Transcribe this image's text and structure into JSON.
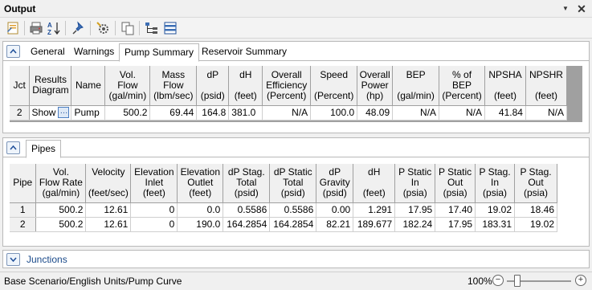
{
  "window": {
    "title": "Output"
  },
  "toolbar": {
    "icons": [
      "report-icon",
      "print-icon",
      "sort-az-icon",
      "pin-icon",
      "settings-icon",
      "copy-icon",
      "tree-icon",
      "columns-icon"
    ]
  },
  "top_panel": {
    "tabs": [
      {
        "label": "General"
      },
      {
        "label": "Warnings"
      },
      {
        "label": "Pump Summary"
      },
      {
        "label": "Reservoir Summary"
      }
    ],
    "active_tab": "Pump Summary",
    "columns": [
      [
        "Jct",
        ""
      ],
      [
        "Results",
        "Diagram"
      ],
      [
        "Name",
        ""
      ],
      [
        "Vol.",
        "Flow",
        "(gal/min)"
      ],
      [
        "Mass",
        "Flow",
        "(lbm/sec)"
      ],
      [
        "dP",
        "",
        "(psid)"
      ],
      [
        "dH",
        "",
        "(feet)"
      ],
      [
        "Overall",
        "Efficiency",
        "(Percent)"
      ],
      [
        "Speed",
        "",
        "(Percent)"
      ],
      [
        "Overall",
        "Power",
        "(hp)"
      ],
      [
        "BEP",
        "",
        "(gal/min)"
      ],
      [
        "% of",
        "BEP",
        "(Percent)"
      ],
      [
        "NPSHA",
        "",
        "(feet)"
      ],
      [
        "NPSHR",
        "",
        "(feet)"
      ]
    ],
    "rows": [
      {
        "jct": "2",
        "diagram": "Show",
        "name": "Pump",
        "vol_flow": "500.2",
        "mass_flow": "69.44",
        "dp": "164.8",
        "dh": "381.0",
        "efficiency": "N/A",
        "speed": "100.0",
        "power": "48.09",
        "bep": "N/A",
        "pct_bep": "N/A",
        "npsha": "41.84",
        "npshr": "N/A"
      }
    ]
  },
  "pipes_panel": {
    "tab": "Pipes",
    "columns": [
      [
        "Pipe",
        ""
      ],
      [
        "Vol.",
        "Flow Rate",
        "(gal/min)"
      ],
      [
        "Velocity",
        "",
        "(feet/sec)"
      ],
      [
        "Elevation",
        "Inlet",
        "(feet)"
      ],
      [
        "Elevation",
        "Outlet",
        "(feet)"
      ],
      [
        "dP Stag.",
        "Total",
        "(psid)"
      ],
      [
        "dP Static",
        "Total",
        "(psid)"
      ],
      [
        "dP",
        "Gravity",
        "(psid)"
      ],
      [
        "dH",
        "",
        "(feet)"
      ],
      [
        "P Static",
        "In",
        "(psia)"
      ],
      [
        "P Static",
        "Out",
        "(psia)"
      ],
      [
        "P Stag.",
        "In",
        "(psia)"
      ],
      [
        "P Stag.",
        "Out",
        "(psia)"
      ]
    ],
    "rows": [
      [
        "1",
        "500.2",
        "12.61",
        "0",
        "0.0",
        "0.5586",
        "0.5586",
        "0.00",
        "1.291",
        "17.95",
        "17.40",
        "19.02",
        "18.46"
      ],
      [
        "2",
        "500.2",
        "12.61",
        "0",
        "190.0",
        "164.2854",
        "164.2854",
        "82.21",
        "189.677",
        "182.24",
        "17.95",
        "183.31",
        "19.02"
      ]
    ]
  },
  "junctions_panel": {
    "label": "Junctions"
  },
  "status": {
    "text": "Base Scenario/English Units/Pump Curve",
    "zoom": "100%"
  }
}
